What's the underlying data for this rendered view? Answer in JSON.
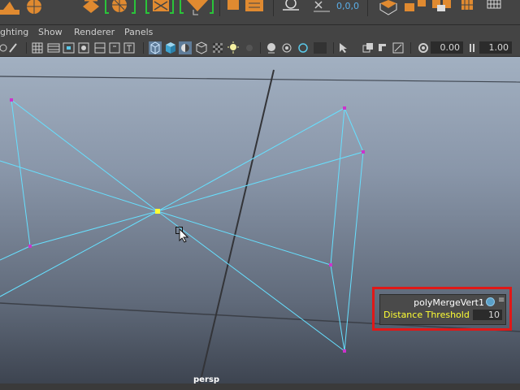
{
  "shelf": {
    "icons": [
      "poly-cone-icon",
      "poly-sphere-icon",
      "poly-diamond-icon",
      "poly-pipe-icon",
      "poly-combine-icon",
      "poly-separate-icon",
      "poly-extract-icon",
      "poly-smooth-icon",
      "poly-lattice-icon",
      "camera-icon",
      "transform-xyz-icon",
      "component-cube-icon",
      "face-select-icon",
      "multi-cube-icon",
      "grid-icon"
    ],
    "coord_readout": "0,0,0"
  },
  "menubar": {
    "items": [
      "ghting",
      "Show",
      "Renderer",
      "Panels"
    ]
  },
  "toolbar": {
    "field_a": "0.00",
    "field_b": "1.00"
  },
  "viewport": {
    "camera_label": "persp",
    "wire_color": "#66e0ff",
    "vertex_color": "#cc33cc",
    "selected_vertex_color": "#ffff33"
  },
  "hud": {
    "title": "polyMergeVert1",
    "attribute_label": "Distance Threshold",
    "attribute_value": "10",
    "highlight_color": "#e01818"
  }
}
